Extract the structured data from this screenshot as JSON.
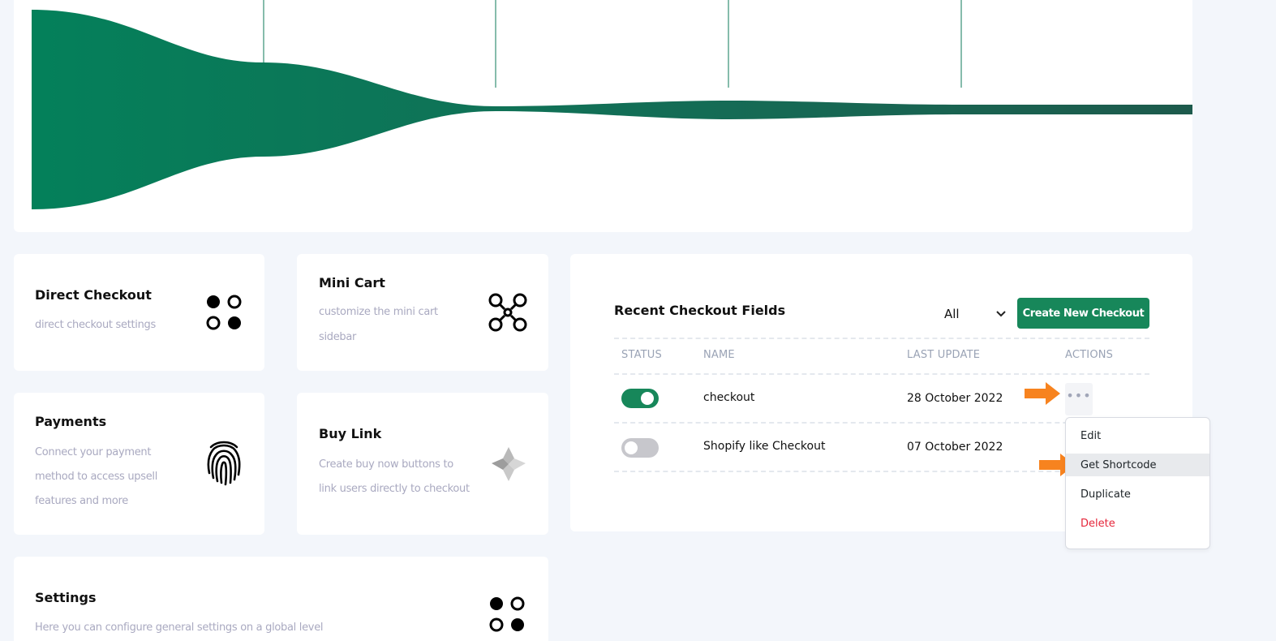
{
  "cards": {
    "direct_checkout": {
      "title": "Direct Checkout",
      "desc": "direct checkout settings",
      "icon": "four-circles-icon"
    },
    "mini_cart": {
      "title": "Mini Cart",
      "desc_line1": "customize the mini cart",
      "desc_line2": "sidebar",
      "icon": "drone-icon"
    },
    "payments": {
      "title": "Payments",
      "desc_line1": "Connect your payment",
      "desc_line2": "method to access upsell",
      "desc_line3": "features and more",
      "icon": "fingerprint-icon"
    },
    "buy_link": {
      "title": "Buy Link",
      "desc_line1": "Create buy now buttons to",
      "desc_line2": "link users directly to checkout",
      "icon": "star-icon"
    },
    "settings": {
      "title": "Settings",
      "desc": "Here you can configure general settings on a global level",
      "icon": "four-circles-icon"
    }
  },
  "recent": {
    "title": "Recent Checkout Fields",
    "filter_value": "All",
    "create_label": "Create New Checkout",
    "columns": [
      "STATUS",
      "NAME",
      "LAST UPDATE",
      "ACTIONS"
    ],
    "rows": [
      {
        "enabled": true,
        "name": "checkout",
        "last_update": "28 October 2022"
      },
      {
        "enabled": false,
        "name": "Shopify like Checkout",
        "last_update": "07 October 2022"
      }
    ],
    "actions_label": "•••"
  },
  "menu": {
    "items": [
      {
        "label": "Edit"
      },
      {
        "label": "Get Shortcode"
      },
      {
        "label": "Duplicate"
      },
      {
        "label": "Delete"
      }
    ]
  },
  "colors": {
    "accent": "#17875a",
    "funnel": "#0d7a5a",
    "arrow": "#f7831f",
    "danger": "#e5263a"
  }
}
